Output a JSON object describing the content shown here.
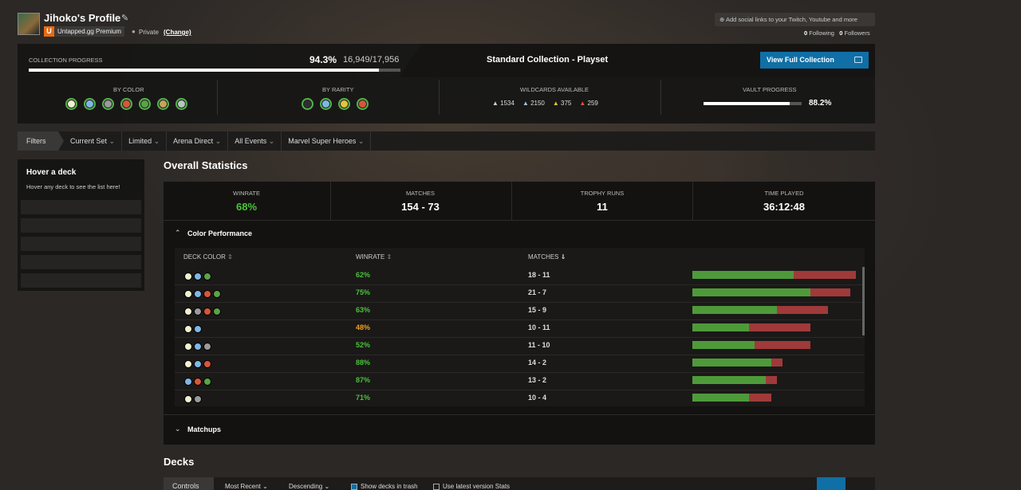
{
  "header": {
    "profile_title": "Jihoko's Profile",
    "badge_letter": "U",
    "premium": "Untapped.gg Premium",
    "privacy": "Private",
    "change": "(Change)",
    "social": "Add social links to your Twitch, Youtube and more",
    "following_count": "0",
    "following_label": "Following",
    "followers_count": "0",
    "followers_label": "Followers"
  },
  "collection": {
    "label": "COLLECTION PROGRESS",
    "percent": "94.3%",
    "count": "16,949/17,956",
    "progress_fraction": 0.943,
    "standard": "Standard Collection - Playset",
    "view_button": "View Full Collection",
    "by_color": "BY COLOR",
    "by_rarity": "BY RARITY",
    "wildcards": "WILDCARDS AVAILABLE",
    "vault": "VAULT PROGRESS",
    "vault_percent": "88.2%",
    "vault_fraction": 0.882,
    "wildcard_counts": [
      "1534",
      "2150",
      "375",
      "259"
    ],
    "wildcard_colors": [
      "#cfcfcf",
      "#9fc3e0",
      "#e7c23a",
      "#d9553a"
    ],
    "color_icons": [
      "#f3efd0",
      "#7fb6e6",
      "#9a9a9a",
      "#d9553a",
      "#5aa347",
      "#c8a45a",
      "#b7c7c0"
    ],
    "rarity_icons": [
      "#2e2e2e",
      "#7fb6e6",
      "#e7c23a",
      "#d9553a"
    ]
  },
  "filters": {
    "label": "Filters",
    "items": [
      "Current Set",
      "Limited",
      "Arena Direct",
      "All Events",
      "Marvel Super Heroes"
    ]
  },
  "hover": {
    "title": "Hover a deck",
    "subtitle": "Hover any deck to see the list here!"
  },
  "overall": {
    "title": "Overall Statistics",
    "stats": [
      {
        "label": "WINRATE",
        "value": "68%"
      },
      {
        "label": "MATCHES",
        "value": "154 - 73"
      },
      {
        "label": "TROPHY RUNS",
        "value": "11"
      },
      {
        "label": "TIME PLAYED",
        "value": "36:12:48"
      }
    ],
    "color_performance": "Color Performance",
    "matchups": "Matchups",
    "columns": {
      "deck_color": "DECK COLOR",
      "winrate": "WINRATE",
      "matches": "MATCHES"
    },
    "rows": [
      {
        "pips": [
          "#f3efd0",
          "#7fb6e6",
          "#5aa347"
        ],
        "winrate": "62%",
        "matches": "18 - 11",
        "wins": 18,
        "losses": 11,
        "wr_color": "#4cc23a"
      },
      {
        "pips": [
          "#f3efd0",
          "#7fb6e6",
          "#d9553a",
          "#5aa347"
        ],
        "winrate": "75%",
        "matches": "21 - 7",
        "wins": 21,
        "losses": 7,
        "wr_color": "#4cc23a"
      },
      {
        "pips": [
          "#f3efd0",
          "#9a9a9a",
          "#d9553a",
          "#5aa347"
        ],
        "winrate": "63%",
        "matches": "15 - 9",
        "wins": 15,
        "losses": 9,
        "wr_color": "#4cc23a"
      },
      {
        "pips": [
          "#f3efd0",
          "#7fb6e6"
        ],
        "winrate": "48%",
        "matches": "10 - 11",
        "wins": 10,
        "losses": 11,
        "wr_color": "#f0a020"
      },
      {
        "pips": [
          "#f3efd0",
          "#7fb6e6",
          "#9a9a9a"
        ],
        "winrate": "52%",
        "matches": "11 - 10",
        "wins": 11,
        "losses": 10,
        "wr_color": "#4cc23a"
      },
      {
        "pips": [
          "#f3efd0",
          "#7fb6e6",
          "#d9553a"
        ],
        "winrate": "88%",
        "matches": "14 - 2",
        "wins": 14,
        "losses": 2,
        "wr_color": "#4cc23a"
      },
      {
        "pips": [
          "#7fb6e6",
          "#d9553a",
          "#5aa347"
        ],
        "winrate": "87%",
        "matches": "13 - 2",
        "wins": 13,
        "losses": 2,
        "wr_color": "#4cc23a"
      },
      {
        "pips": [
          "#f3efd0",
          "#9a9a9a"
        ],
        "winrate": "71%",
        "matches": "10 - 4",
        "wins": 10,
        "losses": 4,
        "wr_color": "#4cc23a"
      }
    ]
  },
  "decks": {
    "title": "Decks",
    "controls": "Controls",
    "sort": "Most Recent",
    "order": "Descending",
    "show_trash": "Show decks in trash",
    "latest": "Use latest version Stats"
  }
}
